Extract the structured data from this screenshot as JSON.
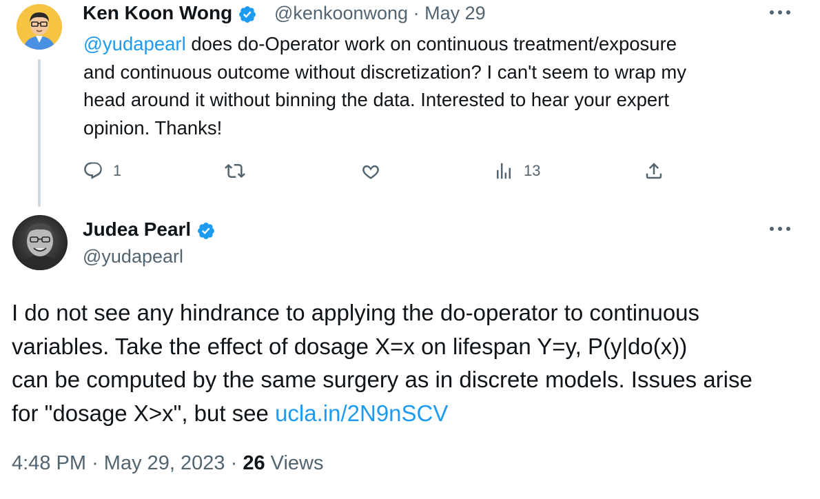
{
  "parent_tweet": {
    "author_name": "Ken Koon Wong",
    "handle": "@kenkoonwong",
    "separator": "·",
    "date": "May 29",
    "mention": "@yudapearl",
    "text_line1": " does do-Operator work on continuous treatment/exposure",
    "text_line2": "and continuous outcome without discretization? I can't seem to wrap my",
    "text_line3": "head around it without binning the data. Interested to hear your expert",
    "text_line4": "opinion. Thanks!",
    "reply_count": "1",
    "retweet_count": "",
    "like_count": "",
    "view_count": "13"
  },
  "reply_tweet": {
    "author_name": "Judea Pearl",
    "handle": "@yudapearl",
    "text_line1": "I do not see any hindrance to applying the do-operator to continuous",
    "text_line2": "variables. Take the effect of dosage X=x on lifespan Y=y, P(y|do(x))",
    "text_line3": "can be computed by the same surgery as in discrete models. Issues arise",
    "text_line4_prefix": "for \"dosage X>x\", but see ",
    "link_text": "ucla.in/2N9nSCV",
    "time": "4:48 PM",
    "date": "May 29, 2023",
    "views_count": "26",
    "views_label": "Views"
  },
  "colors": {
    "accent": "#1d9bf0",
    "secondary_text": "#536471",
    "primary_text": "#0f1419",
    "thread_line": "#cfd9de"
  },
  "icons": [
    "verified-badge-icon",
    "more-icon",
    "reply-icon",
    "retweet-icon",
    "like-icon",
    "views-icon",
    "share-icon"
  ]
}
